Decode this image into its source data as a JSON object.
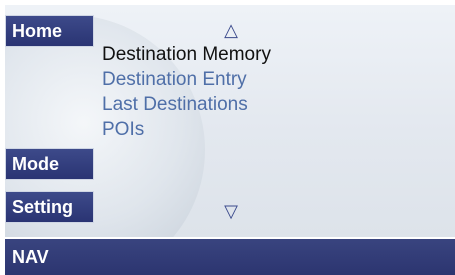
{
  "side_buttons": {
    "home": "Home",
    "mode": "Mode",
    "setting": "Setting"
  },
  "scroll": {
    "up_icon": "△",
    "down_icon": "▽"
  },
  "menu": {
    "items": [
      {
        "label": "Destination Memory",
        "selected": true
      },
      {
        "label": "Destination Entry",
        "selected": false
      },
      {
        "label": "Last Destinations",
        "selected": false
      },
      {
        "label": "POIs",
        "selected": false
      }
    ]
  },
  "status_bar": {
    "label": "NAV"
  },
  "colors": {
    "button_bg": "#2f3978",
    "selected_text": "#111111",
    "item_text": "#4f6fa8",
    "status_bg": "#333d78"
  }
}
